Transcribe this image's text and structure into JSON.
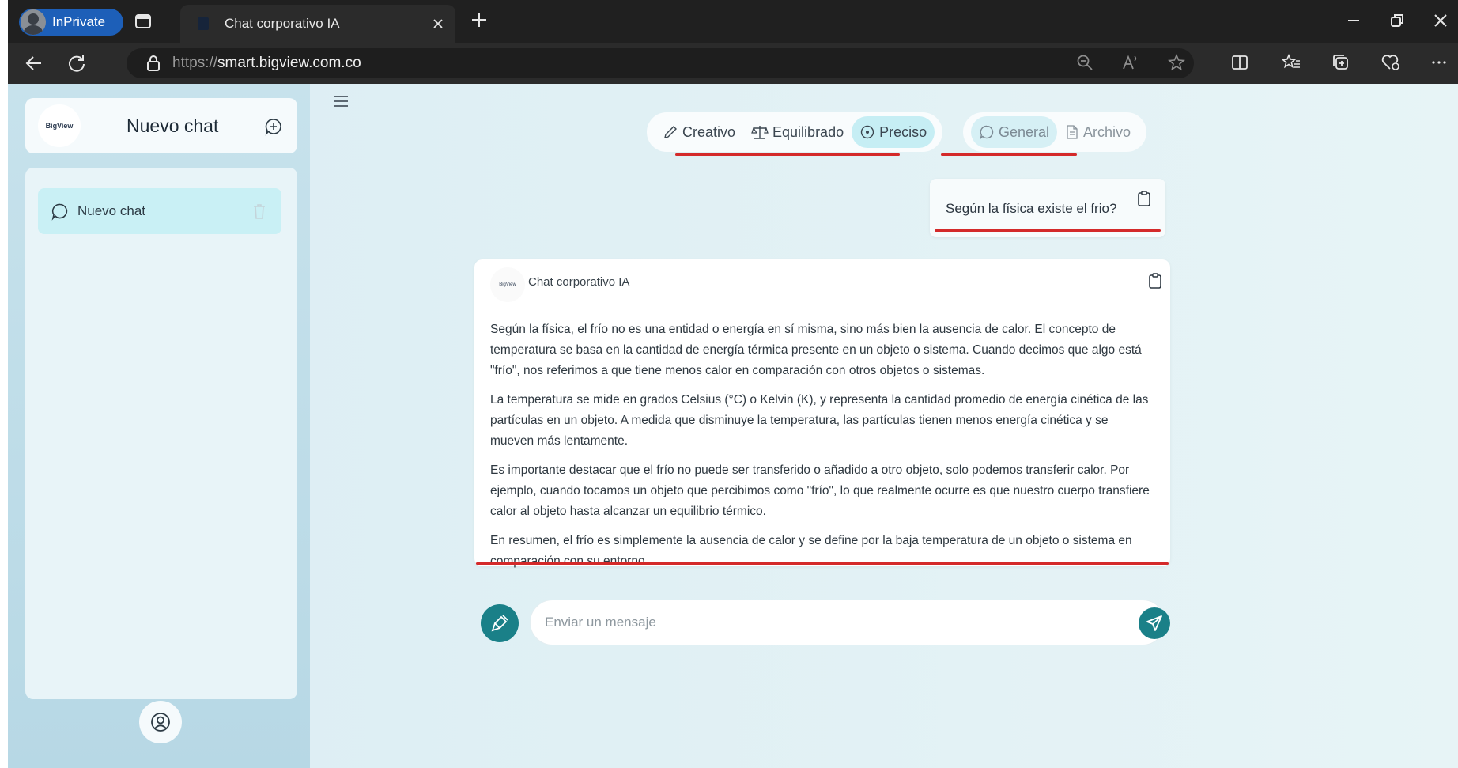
{
  "browser": {
    "inprivate_label": "InPrivate",
    "tab_title": "Chat corporativo IA",
    "url_scheme": "https://",
    "url_host": "smart.bigview.com.co"
  },
  "sidebar": {
    "logo_text": "BigView",
    "title": "Nuevo chat",
    "items": [
      {
        "label": "Nuevo chat"
      }
    ]
  },
  "modes": {
    "items": [
      {
        "label": "Creativo",
        "icon": "pencil-icon"
      },
      {
        "label": "Equilibrado",
        "icon": "scale-icon"
      },
      {
        "label": "Preciso",
        "icon": "target-icon",
        "active": true
      }
    ]
  },
  "sources": {
    "items": [
      {
        "label": "General",
        "icon": "chat-bubble-icon",
        "active": true
      },
      {
        "label": "Archivo",
        "icon": "document-icon"
      }
    ]
  },
  "conversation": {
    "user_message": "Según la física existe el frio?",
    "bot_avatar_text": "BigView",
    "bot_name": "Chat corporativo IA",
    "bot_paragraphs": [
      "Según la física, el frío no es una entidad o energía en sí misma, sino más bien la ausencia de calor. El concepto de temperatura se basa en la cantidad de energía térmica presente en un objeto o sistema. Cuando decimos que algo está \"frío\", nos referimos a que tiene menos calor en comparación con otros objetos o sistemas.",
      "La temperatura se mide en grados Celsius (°C) o Kelvin (K), y representa la cantidad promedio de energía cinética de las partículas en un objeto. A medida que disminuye la temperatura, las partículas tienen menos energía cinética y se mueven más lentamente.",
      "Es importante destacar que el frío no puede ser transferido o añadido a otro objeto, solo podemos transferir calor. Por ejemplo, cuando tocamos un objeto que percibimos como \"frío\", lo que realmente ocurre es que nuestro cuerpo transfiere calor al objeto hasta alcanzar un equilibrio térmico.",
      "En resumen, el frío es simplemente la ausencia de calor y se define por la baja temperatura de un objeto o sistema en comparación con su entorno."
    ]
  },
  "composer": {
    "placeholder": "Enviar un mensaje"
  },
  "colors": {
    "accent": "#1a8088",
    "highlight_underline": "#d42a2a",
    "active_pill": "#c6eef4"
  }
}
